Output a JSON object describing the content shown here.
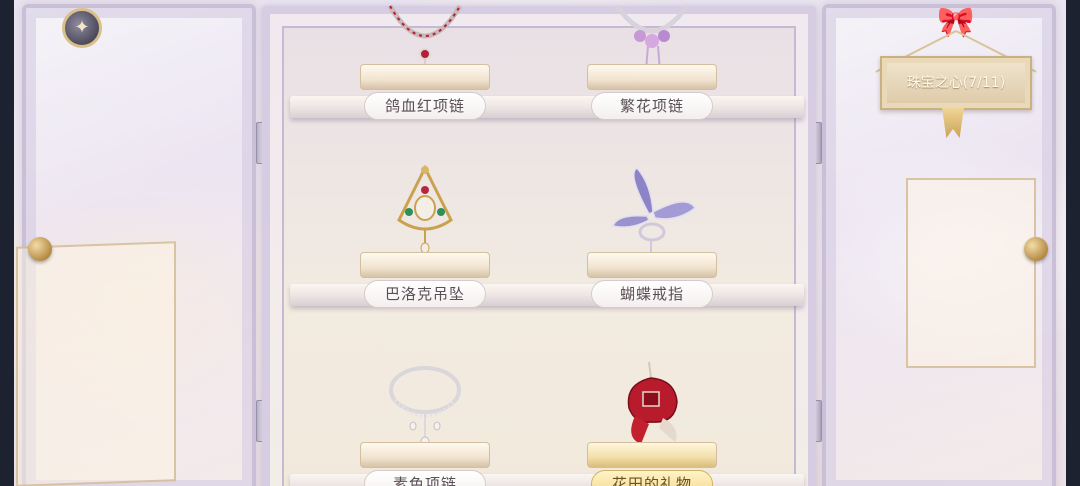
{
  "collection": {
    "title": "珠宝之心(7/11)"
  },
  "shelves": [
    {
      "items": [
        {
          "name": "鸽血红项链",
          "icon": "ruby-necklace-icon",
          "highlighted": false
        },
        {
          "name": "繁花项链",
          "icon": "floral-necklace-icon",
          "highlighted": false
        }
      ]
    },
    {
      "items": [
        {
          "name": "巴洛克吊坠",
          "icon": "baroque-pendant-icon",
          "highlighted": false
        },
        {
          "name": "蝴蝶戒指",
          "icon": "butterfly-ring-icon",
          "highlighted": false
        }
      ]
    },
    {
      "items": [
        {
          "name": "素色项链",
          "icon": "plain-necklace-icon",
          "highlighted": false
        },
        {
          "name": "花田的礼物",
          "icon": "rose-brooch-icon",
          "highlighted": true
        }
      ]
    }
  ],
  "colors": {
    "label_normal": "#ffffff",
    "label_highlight": "#f2d889",
    "frame": "#d6cde2",
    "gold": "#c9a456"
  }
}
